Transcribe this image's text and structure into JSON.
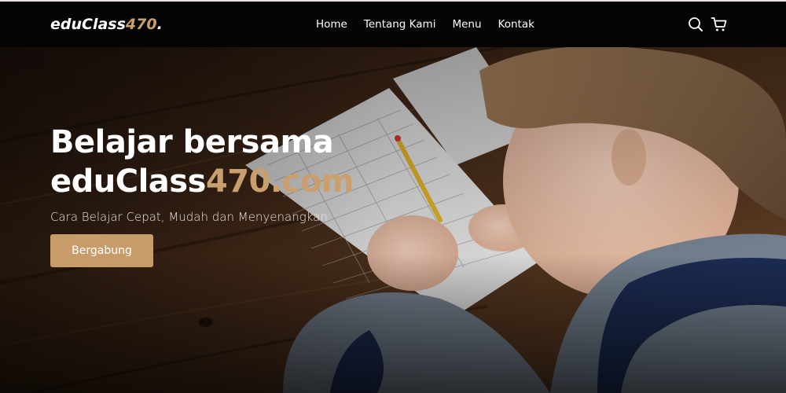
{
  "navbar": {
    "brand": {
      "main": "eduClass",
      "accent": "470",
      "suffix": "."
    },
    "links": [
      {
        "label": "Home"
      },
      {
        "label": "Tentang Kami"
      },
      {
        "label": "Menu"
      },
      {
        "label": "Kontak"
      }
    ],
    "icons": [
      "search-icon",
      "cart-icon"
    ]
  },
  "hero": {
    "title_line1": "Belajar bersama",
    "title_line2_main": "eduClass",
    "title_line2_accent": "470.com",
    "subtitle": "Cara Belajar Cepat, Mudah dan Menyenangkan",
    "cta_label": "Bergabung",
    "image": "child-writing-worksheet-photo"
  },
  "colors": {
    "accent": "#c9a06d",
    "button": "#c89c6a",
    "navbar_bg": "#040404",
    "text": "#ffffff"
  }
}
